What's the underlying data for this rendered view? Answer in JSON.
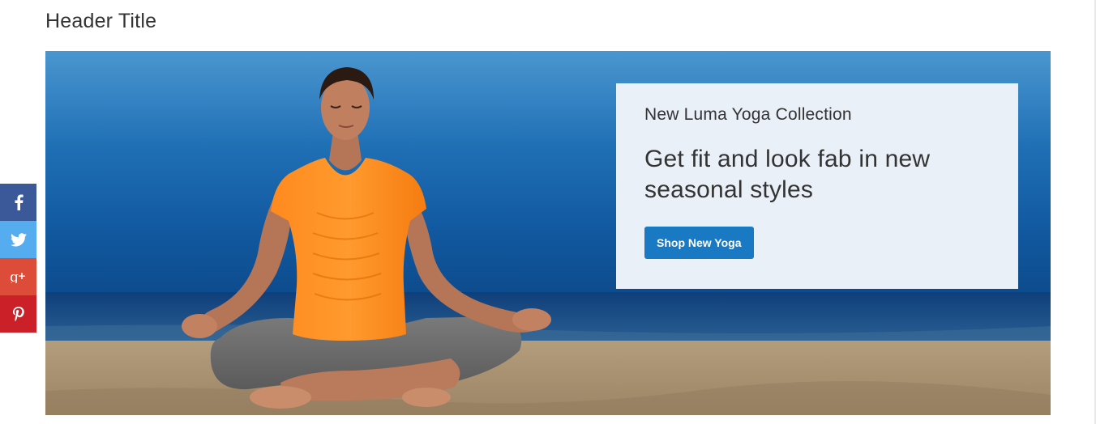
{
  "header": {
    "title": "Header Title"
  },
  "hero": {
    "subtitle": "New Luma Yoga Collection",
    "headline": "Get fit and look fab in new seasonal styles",
    "button_label": "Shop New Yoga",
    "image_description_icon": "yoga-woman-beach-image"
  },
  "social": {
    "items": [
      {
        "icon": "facebook-icon",
        "color": "#3b5998"
      },
      {
        "icon": "twitter-icon",
        "color": "#55acee"
      },
      {
        "icon": "google-plus-icon",
        "color": "#dd4b39"
      },
      {
        "icon": "pinterest-icon",
        "color": "#cb2027"
      }
    ]
  },
  "colors": {
    "button": "#1979c3",
    "promo_background": "#e9f0f7",
    "text": "#333333"
  }
}
